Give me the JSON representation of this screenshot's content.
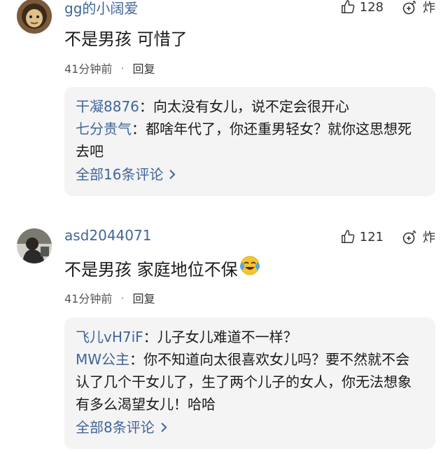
{
  "comments": [
    {
      "username": "gg的小阔爱",
      "likes": "128",
      "burst_label": "炸",
      "text": "不是男孩 可惜了",
      "time": "41分钟前",
      "reply_label": "回复",
      "replies": [
        {
          "author": "干凝8876",
          "sep": "：",
          "text": "向太没有女儿，说不定会很开心"
        },
        {
          "author": "七分贵气",
          "sep": "：",
          "text": "都啥年代了，你还重男轻女？就你这思想死去吧"
        }
      ],
      "all_replies": "全部16条评论",
      "avatar_icon": "user-avatar-photo"
    },
    {
      "username": "asd2044071",
      "likes": "121",
      "burst_label": "炸",
      "text": "不是男孩 家庭地位不保",
      "emoji": "laughing-crying-emoji",
      "time": "41分钟前",
      "reply_label": "回复",
      "replies": [
        {
          "author": "飞儿vH7iF",
          "sep": "：",
          "text": "儿子女儿难道不一样？"
        },
        {
          "author": "MW公主",
          "sep": "：",
          "text": "你不知道向太很喜欢女儿吗？要不然就不会认了几个干女儿了，生了两个儿子的女人，你无法想象有多么渴望女儿！哈哈"
        }
      ],
      "all_replies": "全部8条评论",
      "avatar_icon": "user-avatar-photo"
    }
  ],
  "colors": {
    "link": "#406599",
    "reply_bg": "#f4f4f4",
    "text": "#1a1a1a"
  }
}
